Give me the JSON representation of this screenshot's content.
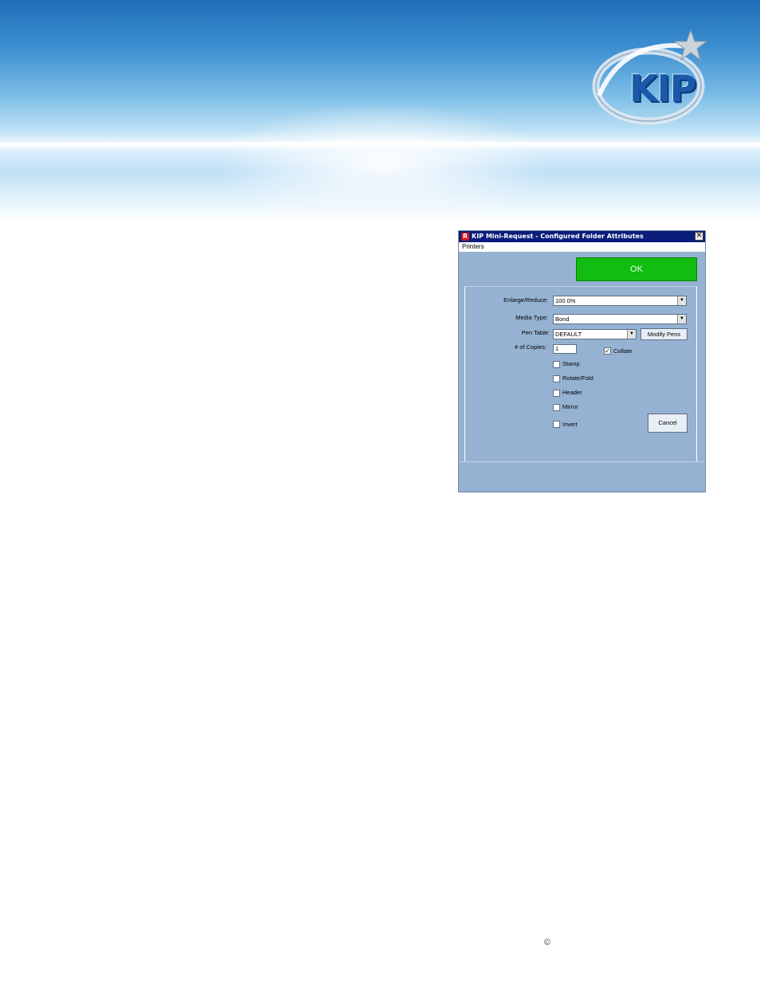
{
  "banner": {
    "logo_text": "KIP"
  },
  "dialog": {
    "title": "KIP Mini-Request - Configured Folder Attributes",
    "app_icon": "R",
    "close_glyph": "✕",
    "menu": [
      "Printers"
    ],
    "ok_label": "OK",
    "fields": {
      "enlarge_reduce_label": "Enlarge/Reduce:",
      "enlarge_reduce_value": "100.0%",
      "media_type_label": "Media Type:",
      "media_type_value": "Bond",
      "pen_table_label": "Pen Table:",
      "pen_table_value": "DEFAULT",
      "modify_pens_label": "Modify Pens",
      "copies_label": "# of Copies:",
      "copies_value": "1"
    },
    "checkboxes": {
      "collate": {
        "label": "Collate",
        "checked": true
      },
      "stamp": {
        "label": "Stamp",
        "checked": false
      },
      "rotate_fold": {
        "label": "Rotate/Fold",
        "checked": false
      },
      "header": {
        "label": "Header",
        "checked": false
      },
      "mirror": {
        "label": "Mirror",
        "checked": false
      },
      "invert": {
        "label": "Invert",
        "checked": false
      }
    },
    "cancel_label": "Cancel",
    "colors": {
      "titlebar": "#0a1d7a",
      "background": "#96b2d2",
      "ok_button": "#10bd10"
    }
  },
  "footer": {
    "copyright_symbol": "©"
  }
}
